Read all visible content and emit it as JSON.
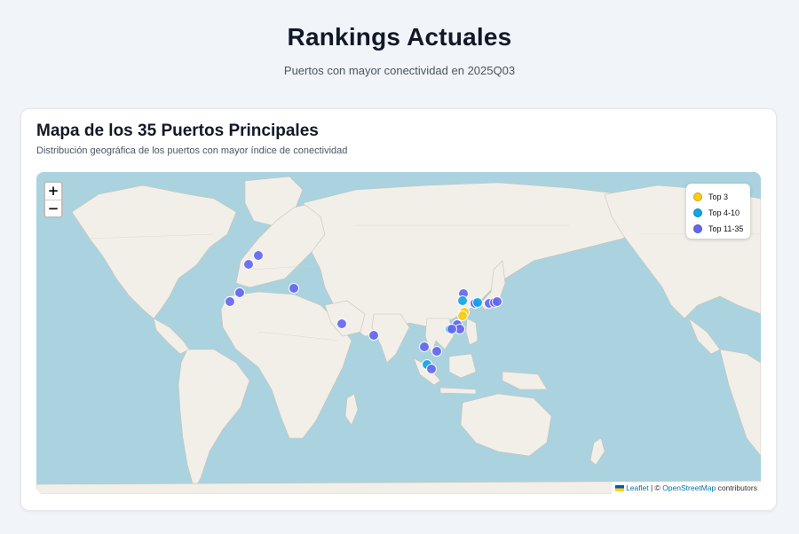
{
  "header": {
    "title": "Rankings Actuales",
    "subtitle": "Puertos con mayor conectividad en 2025Q03"
  },
  "map_card": {
    "title": "Mapa de los 35 Puertos Principales",
    "subtitle": "Distribución geográfica de los puertos con mayor índice de conectividad"
  },
  "zoom": {
    "in_label": "+",
    "out_label": "−"
  },
  "legend": {
    "items": [
      {
        "label": "Top 3",
        "color": "#facc15"
      },
      {
        "label": "Top 4-10",
        "color": "#0ea5e9"
      },
      {
        "label": "Top 11-35",
        "color": "#6366f1"
      }
    ]
  },
  "attribution": {
    "leaflet": "Leaflet",
    "separator": "| ©",
    "osm": "OpenStreetMap",
    "suffix": "contributors"
  },
  "colors": {
    "ocean": "#aad3df",
    "land": "#f2efe9",
    "top3": "#facc15",
    "top4_10": "#0ea5e9",
    "top11_35": "#6366f1"
  }
}
